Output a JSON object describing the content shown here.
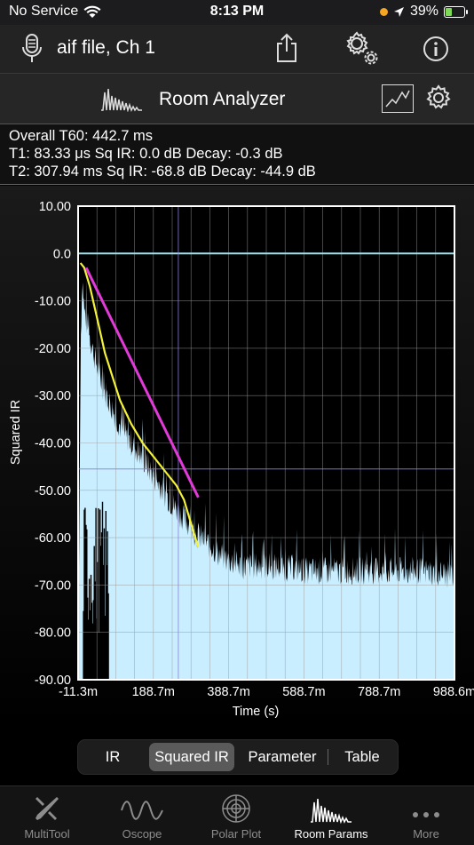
{
  "status": {
    "carrier": "No Service",
    "time": "8:13 PM",
    "battery": "39%",
    "battery_level": 0.39
  },
  "header": {
    "title": "aif file, Ch 1"
  },
  "analyzer": {
    "title": "Room Analyzer"
  },
  "params": {
    "line1": "Overall T60:  442.7 ms",
    "line2": "T1: 83.33 μs  Sq IR: 0.0 dB  Decay: -0.3 dB",
    "line3": "T2: 307.94 ms  Sq IR: -68.8 dB  Decay: -44.9 dB"
  },
  "chart_data": {
    "type": "area",
    "ylabel": "Squared IR",
    "xlabel": "Time (s)",
    "xlim": [
      -11.3,
      988.6
    ],
    "ylim": [
      -90,
      10
    ],
    "x_ticks": [
      "-11.3m",
      "188.7m",
      "388.7m",
      "588.7m",
      "788.7m",
      "988.6m"
    ],
    "y_ticks": [
      "10.00",
      "0.0",
      "-10.00",
      "-20.00",
      "-30.00",
      "-40.00",
      "-50.00",
      "-60.00",
      "-70.00",
      "-80.00",
      "-90.00"
    ],
    "grid": true,
    "colors": {
      "fill": "#c9eeff",
      "baseline": "#9fe3f0",
      "magenta": "#e23ad8",
      "yellow": "#f4f238",
      "marker": "#8a7fd6"
    },
    "magenta_line": {
      "x": [
        10,
        308
      ],
      "y": [
        -3,
        -51.5
      ]
    },
    "yellow_curve": {
      "x": [
        -5,
        5,
        20,
        40,
        60,
        80,
        100,
        130,
        160,
        190,
        220,
        250,
        270,
        285,
        300,
        308
      ],
      "y": [
        -2,
        -3,
        -7,
        -14,
        -21,
        -26,
        -31,
        -36,
        -40,
        -43,
        -46,
        -49,
        -52,
        -56,
        -60,
        -62
      ]
    },
    "markers": {
      "t_ms": 255,
      "level_db": -45.5
    },
    "ir_envelope": {
      "t_ms": [
        -11.3,
        -5,
        0,
        5,
        15,
        30,
        50,
        80,
        110,
        150,
        190,
        230,
        270,
        300,
        330,
        370,
        420,
        500,
        600,
        700,
        800,
        900,
        988.6
      ],
      "db": [
        -90,
        -20,
        -5,
        -12,
        -16,
        -21,
        -27,
        -33,
        -38,
        -42,
        -47,
        -52,
        -56,
        -59,
        -61,
        -64,
        -66,
        -66,
        -67,
        -67,
        -67,
        -67,
        -68
      ]
    }
  },
  "segments": [
    "IR",
    "Squared IR",
    "Parameter",
    "Table"
  ],
  "active_segment": 1,
  "tabs": [
    {
      "label": "MultiTool",
      "icon": "multitool-icon"
    },
    {
      "label": "Oscope",
      "icon": "oscope-icon"
    },
    {
      "label": "Polar Plot",
      "icon": "polar-plot-icon"
    },
    {
      "label": "Room Params",
      "icon": "room-params-icon"
    },
    {
      "label": "More",
      "icon": "more-icon"
    }
  ],
  "active_tab": 3
}
